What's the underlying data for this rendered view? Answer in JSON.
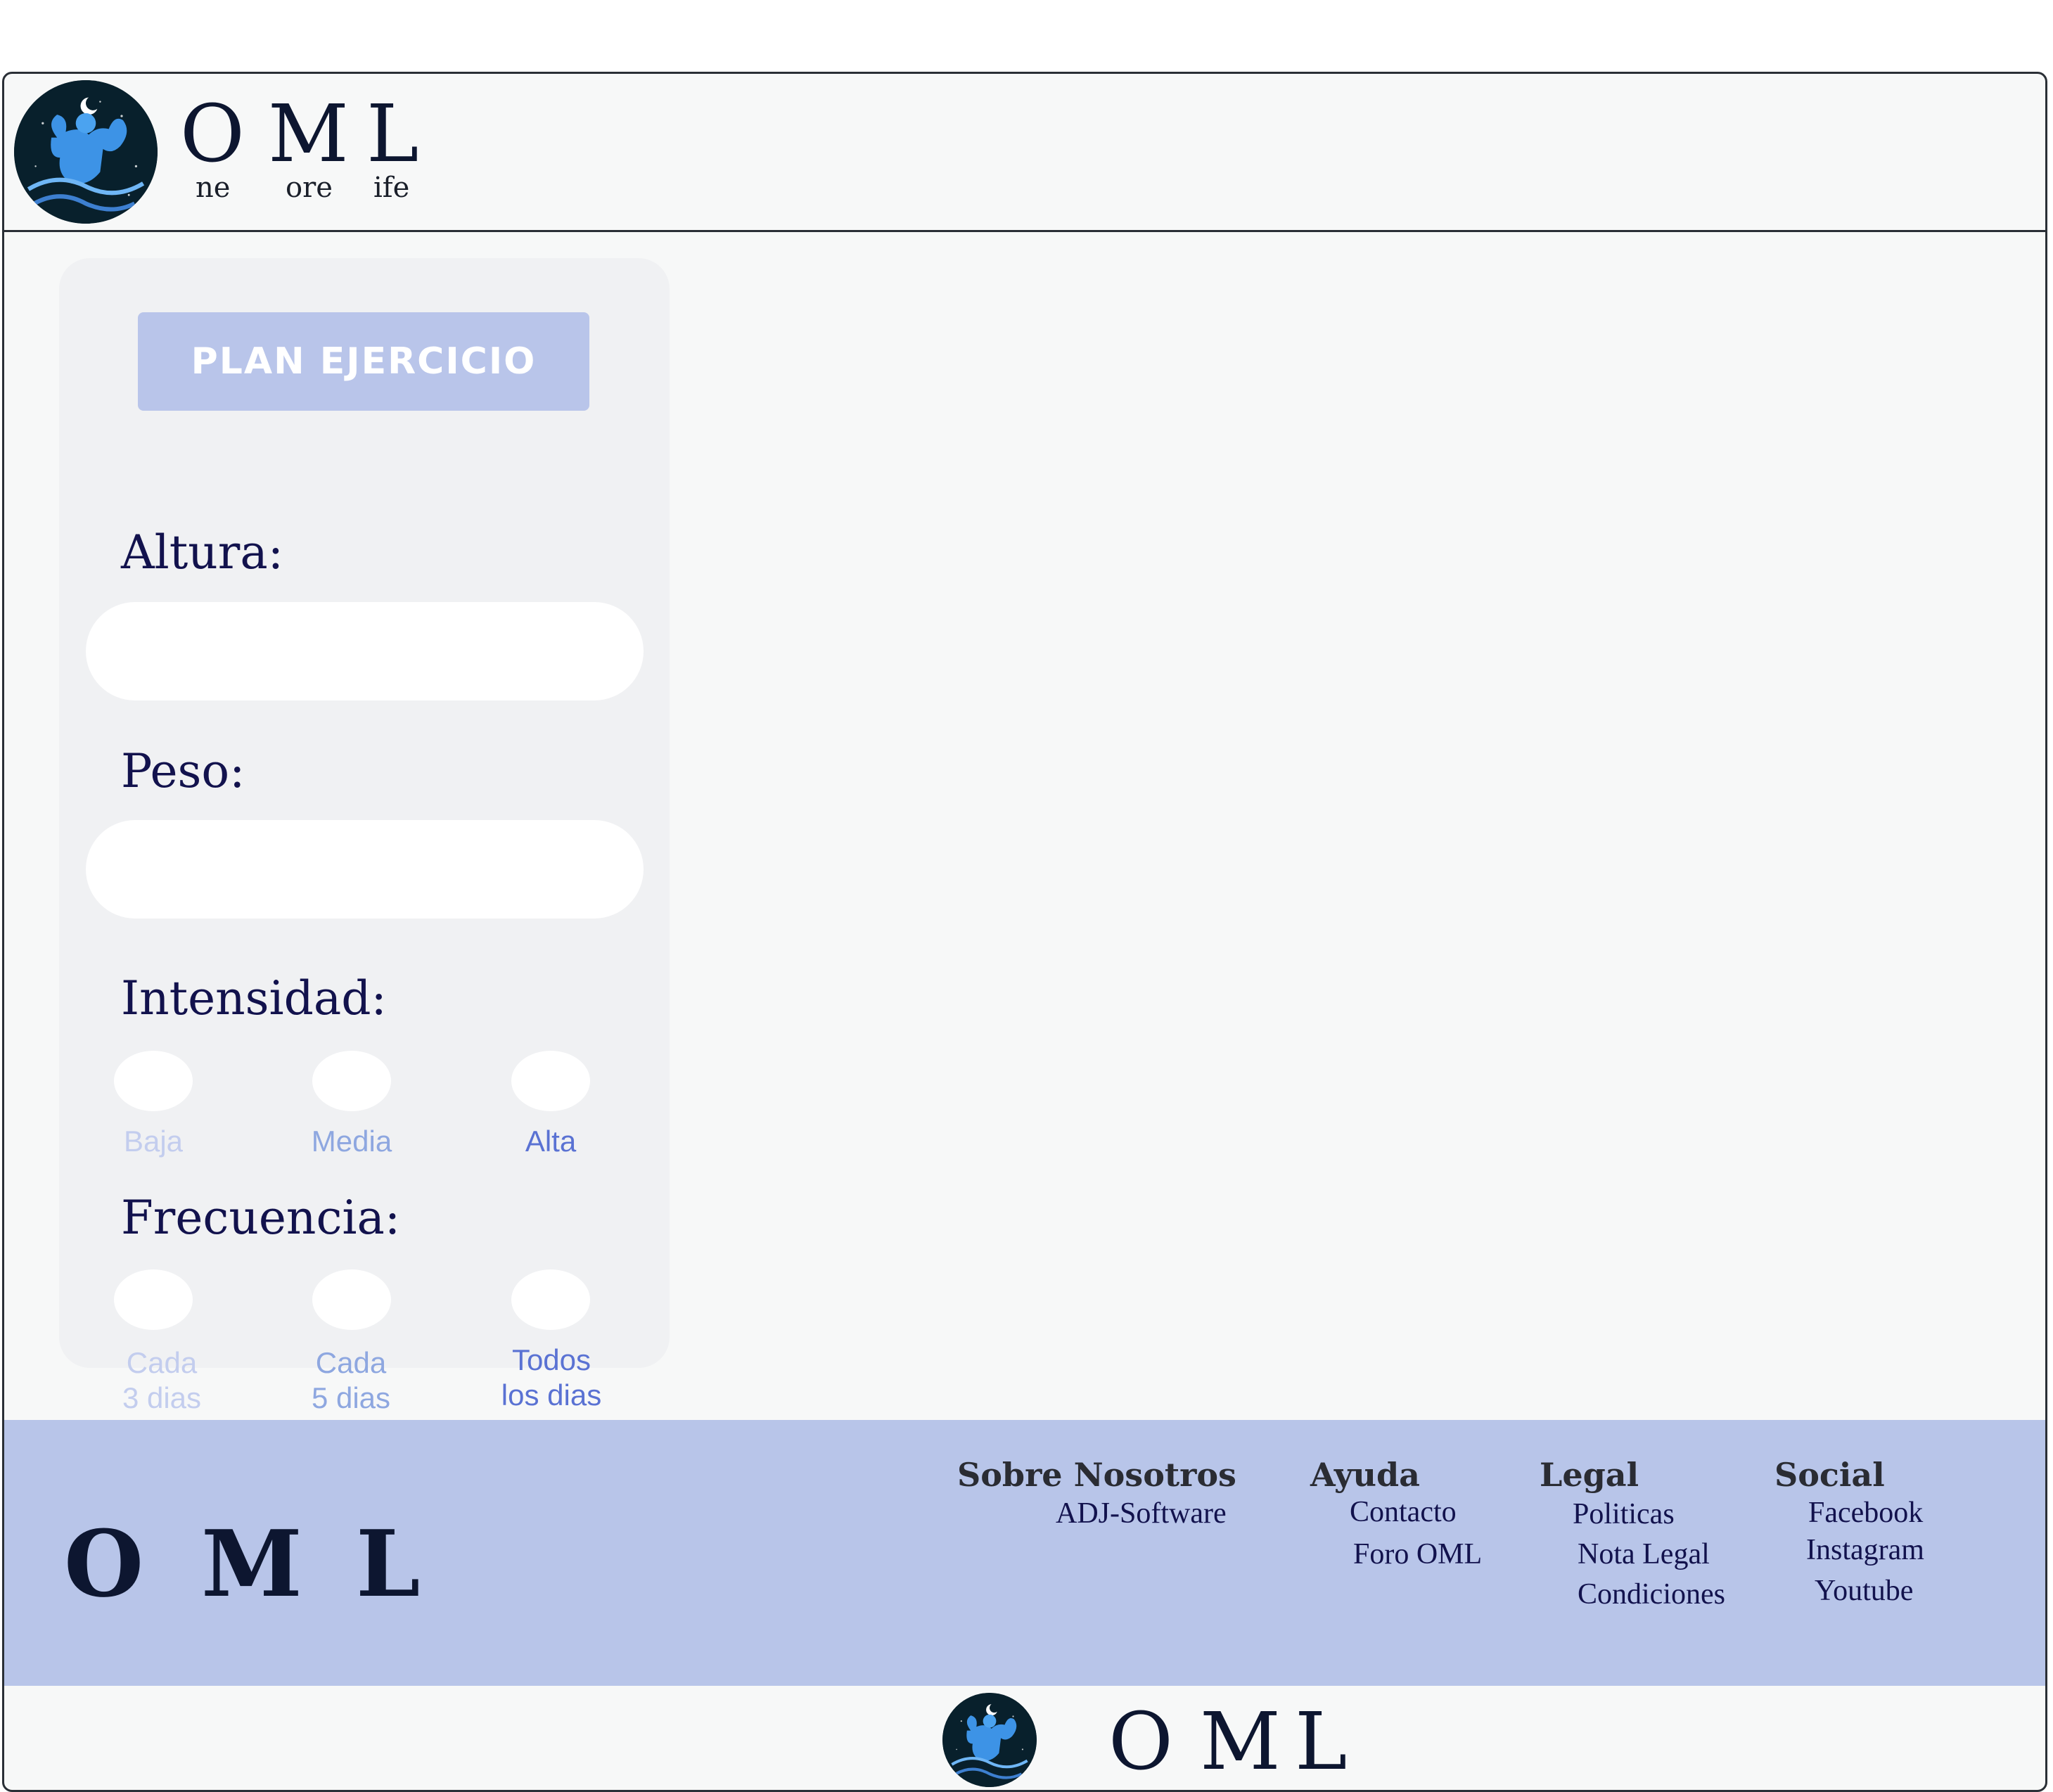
{
  "header": {
    "logo_icon": "muscle-man-icon",
    "brand_letters": [
      "O",
      "M",
      "L"
    ],
    "brand_sub": [
      "ne",
      "ore",
      "ife"
    ]
  },
  "form": {
    "title_button": "PLAN EJERCICIO",
    "altura_label": "Altura:",
    "altura_value": "",
    "peso_label": "Peso:",
    "peso_value": "",
    "intensidad_label": "Intensidad:",
    "intensidad_options": [
      "Baja",
      "Media",
      "Alta"
    ],
    "frecuencia_label": "Frecuencia:",
    "frecuencia_options": [
      {
        "line1": "Cada",
        "line2": "3 dias"
      },
      {
        "line1": "Cada",
        "line2": "5 dias"
      },
      {
        "line1": "Todos",
        "line2": "los dias"
      }
    ]
  },
  "footer": {
    "logo_letters": [
      "O",
      "M",
      "L"
    ],
    "sobre": {
      "heading": "Sobre Nosotros",
      "links": [
        "ADJ-Software"
      ]
    },
    "ayuda": {
      "heading": "Ayuda",
      "links": [
        "Contacto",
        "Foro OML"
      ]
    },
    "legal": {
      "heading": "Legal",
      "links": [
        "Politicas",
        "Nota Legal",
        "Condiciones"
      ]
    },
    "social": {
      "heading": "Social",
      "links": [
        "Facebook",
        "Instagram",
        "Youtube"
      ]
    }
  },
  "bottom_brand": {
    "logo_icon": "muscle-man-icon",
    "letters": [
      "O",
      "M",
      "L"
    ]
  },
  "colors": {
    "accent": "#b9c5ea",
    "label_text": "#12124d",
    "option_light": "#c3cdee",
    "option_mid": "#8ea7e0",
    "option_dark": "#5a72d3",
    "background": "#f7f8f8"
  }
}
